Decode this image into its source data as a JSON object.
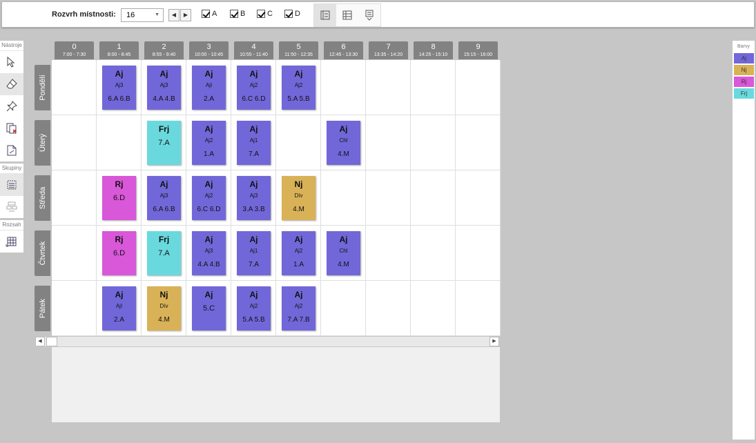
{
  "toolbar": {
    "label": "Rozvrh místnosti:",
    "room_value": "16",
    "checks": [
      {
        "label": "A",
        "checked": true
      },
      {
        "label": "B",
        "checked": true
      },
      {
        "label": "C",
        "checked": true
      },
      {
        "label": "D",
        "checked": true
      }
    ]
  },
  "tools": {
    "title": "Nástroje",
    "groups_title": "Skupiny",
    "range_title": "Rozsah"
  },
  "colors_panel": {
    "title": "Barvy",
    "items": [
      {
        "label": "Aj",
        "color": "#7267d8"
      },
      {
        "label": "Nj",
        "color": "#d9b157"
      },
      {
        "label": "Rj",
        "color": "#d957d9"
      },
      {
        "label": "Frj",
        "color": "#6ad9de"
      }
    ]
  },
  "periods": [
    {
      "num": "0",
      "time": "7:00 - 7:30"
    },
    {
      "num": "1",
      "time": "8:00 - 8:45"
    },
    {
      "num": "2",
      "time": "8:55 - 9:40"
    },
    {
      "num": "3",
      "time": "10:00 - 10:45"
    },
    {
      "num": "4",
      "time": "10:55 - 11:40"
    },
    {
      "num": "5",
      "time": "11:50 - 12:35"
    },
    {
      "num": "6",
      "time": "12:45 - 13:30"
    },
    {
      "num": "7",
      "time": "13:35 - 14:20"
    },
    {
      "num": "8",
      "time": "14:25 - 15:10"
    },
    {
      "num": "9",
      "time": "15:15 - 16:00"
    }
  ],
  "days": [
    "Pondělí",
    "Úterý",
    "Středa",
    "Čtvrtek",
    "Pátek"
  ],
  "lessons": [
    {
      "day": 0,
      "period": 1,
      "subject": "Aj",
      "group": "Aj3",
      "classes": "6.A  6.B",
      "color": "#7267d8"
    },
    {
      "day": 0,
      "period": 2,
      "subject": "Aj",
      "group": "Aj3",
      "classes": "4.A  4.B",
      "color": "#7267d8"
    },
    {
      "day": 0,
      "period": 3,
      "subject": "Aj",
      "group": "AjI",
      "classes": "2.A",
      "color": "#7267d8"
    },
    {
      "day": 0,
      "period": 4,
      "subject": "Aj",
      "group": "Aj2",
      "classes": "6.C  6.D",
      "color": "#7267d8"
    },
    {
      "day": 0,
      "period": 5,
      "subject": "Aj",
      "group": "Aj2",
      "classes": "5.A  5.B",
      "color": "#7267d8"
    },
    {
      "day": 1,
      "period": 2,
      "subject": "Frj",
      "group": "",
      "classes": "7.A",
      "color": "#6ad9de"
    },
    {
      "day": 1,
      "period": 3,
      "subject": "Aj",
      "group": "Aj2",
      "classes": "1.A",
      "color": "#7267d8"
    },
    {
      "day": 1,
      "period": 4,
      "subject": "Aj",
      "group": "Aj1",
      "classes": "7.A",
      "color": "#7267d8"
    },
    {
      "day": 1,
      "period": 6,
      "subject": "Aj",
      "group": "Chl",
      "classes": "4.M",
      "color": "#7267d8"
    },
    {
      "day": 2,
      "period": 1,
      "subject": "Rj",
      "group": "",
      "classes": "6.D",
      "color": "#d957d9"
    },
    {
      "day": 2,
      "period": 2,
      "subject": "Aj",
      "group": "Aj3",
      "classes": "6.A  6.B",
      "color": "#7267d8"
    },
    {
      "day": 2,
      "period": 3,
      "subject": "Aj",
      "group": "Aj2",
      "classes": "6.C  6.D",
      "color": "#7267d8"
    },
    {
      "day": 2,
      "period": 4,
      "subject": "Aj",
      "group": "Aj3",
      "classes": "3.A  3.B",
      "color": "#7267d8"
    },
    {
      "day": 2,
      "period": 5,
      "subject": "Nj",
      "group": "Dív",
      "classes": "4.M",
      "color": "#d9b157"
    },
    {
      "day": 3,
      "period": 1,
      "subject": "Rj",
      "group": "",
      "classes": "6.D",
      "color": "#d957d9"
    },
    {
      "day": 3,
      "period": 2,
      "subject": "Frj",
      "group": "",
      "classes": "7.A",
      "color": "#6ad9de"
    },
    {
      "day": 3,
      "period": 3,
      "subject": "Aj",
      "group": "Aj3",
      "classes": "4.A  4.B",
      "color": "#7267d8"
    },
    {
      "day": 3,
      "period": 4,
      "subject": "Aj",
      "group": "Aj1",
      "classes": "7.A",
      "color": "#7267d8"
    },
    {
      "day": 3,
      "period": 5,
      "subject": "Aj",
      "group": "Aj2",
      "classes": "1.A",
      "color": "#7267d8"
    },
    {
      "day": 3,
      "period": 6,
      "subject": "Aj",
      "group": "Chl",
      "classes": "4.M",
      "color": "#7267d8"
    },
    {
      "day": 4,
      "period": 1,
      "subject": "Aj",
      "group": "AjI",
      "classes": "2.A",
      "color": "#7267d8"
    },
    {
      "day": 4,
      "period": 2,
      "subject": "Nj",
      "group": "Dív",
      "classes": "4.M",
      "color": "#d9b157"
    },
    {
      "day": 4,
      "period": 3,
      "subject": "Aj",
      "group": "",
      "classes": "5.C",
      "color": "#7267d8"
    },
    {
      "day": 4,
      "period": 4,
      "subject": "Aj",
      "group": "Aj2",
      "classes": "5.A  5.B",
      "color": "#7267d8"
    },
    {
      "day": 4,
      "period": 5,
      "subject": "Aj",
      "group": "Aj2",
      "classes": "7.A  7.B",
      "color": "#7267d8"
    }
  ]
}
